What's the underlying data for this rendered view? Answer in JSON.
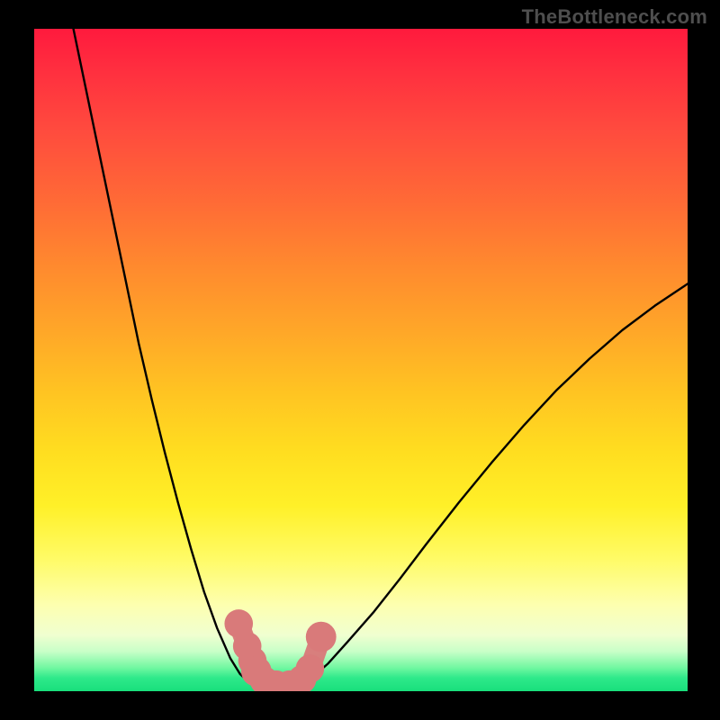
{
  "watermark": "TheBottleneck.com",
  "chart_data": {
    "type": "line",
    "title": "",
    "xlabel": "",
    "ylabel": "",
    "xlim": [
      0,
      100
    ],
    "ylim": [
      0,
      100
    ],
    "series": [
      {
        "name": "left-curve",
        "x": [
          6,
          8,
          10,
          12,
          14,
          16,
          18,
          20,
          22,
          24,
          26,
          28,
          30,
          31.5,
          33,
          34.5,
          36
        ],
        "y": [
          100,
          90.5,
          81,
          71.5,
          62,
          52.5,
          44,
          36,
          28.5,
          21.5,
          15,
          9.5,
          5,
          2.6,
          1.2,
          0.6,
          0.3
        ]
      },
      {
        "name": "floor-curve",
        "x": [
          36,
          38,
          40
        ],
        "y": [
          0.3,
          0.1,
          0.4
        ]
      },
      {
        "name": "right-curve",
        "x": [
          40,
          42,
          45,
          48,
          52,
          56,
          60,
          65,
          70,
          75,
          80,
          85,
          90,
          95,
          100
        ],
        "y": [
          0.4,
          1.6,
          4.2,
          7.5,
          12,
          17,
          22.2,
          28.5,
          34.5,
          40.2,
          45.5,
          50.2,
          54.5,
          58.2,
          61.5
        ]
      }
    ],
    "markers": {
      "name": "highlight-points",
      "color": "#d97a7a",
      "points": [
        {
          "x": 31.3,
          "y": 10.2,
          "r": 1.6
        },
        {
          "x": 32.6,
          "y": 6.8,
          "r": 1.6
        },
        {
          "x": 33.4,
          "y": 4.6,
          "r": 1.6
        },
        {
          "x": 34.0,
          "y": 3.0,
          "r": 1.9
        },
        {
          "x": 35.2,
          "y": 1.6,
          "r": 1.6
        },
        {
          "x": 37.0,
          "y": 1.0,
          "r": 1.6
        },
        {
          "x": 39.1,
          "y": 1.0,
          "r": 1.6
        },
        {
          "x": 41.0,
          "y": 1.8,
          "r": 1.6
        },
        {
          "x": 42.2,
          "y": 3.4,
          "r": 1.6
        },
        {
          "x": 43.9,
          "y": 8.2,
          "r": 1.9
        }
      ]
    }
  },
  "colors": {
    "curve_stroke": "#000000",
    "marker_fill": "#d97a7a",
    "marker_stroke_fill": "#d97a7a"
  }
}
